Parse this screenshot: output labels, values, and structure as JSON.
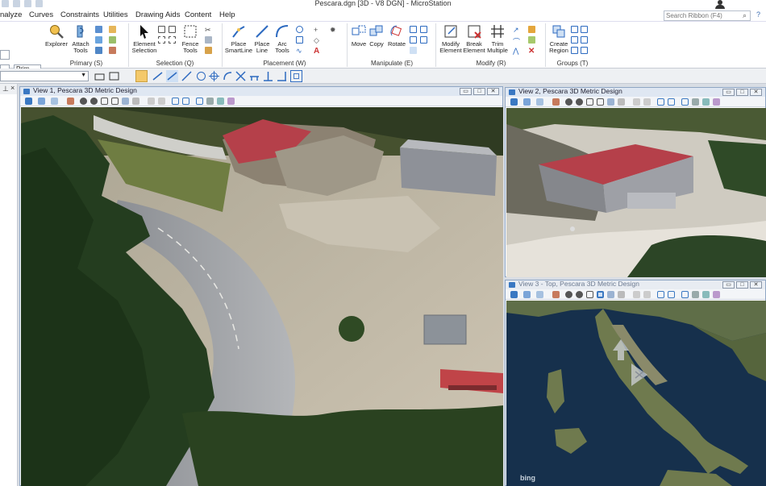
{
  "app": {
    "window_title": "Pescara.dgn [3D - V8 DGN] - MicroStation"
  },
  "menu": {
    "tabs": [
      "nalyze",
      "Curves",
      "Constraints",
      "Utilities",
      "Drawing Aids",
      "Content",
      "Help"
    ]
  },
  "search": {
    "placeholder": "Search Ribbon (F4)"
  },
  "ribbon": {
    "primary": {
      "label": "Primary (S)",
      "prim_value": "Prim",
      "explorer": "Explorer",
      "attach_tools": "Attach Tools"
    },
    "selection": {
      "label": "Selection (Q)",
      "element_selection": "Element Selection",
      "fence_tools": "Fence Tools"
    },
    "placement": {
      "label": "Placement (W)",
      "place_smartline": "Place SmartLine",
      "place_line": "Place Line",
      "arc_tools": "Arc Tools"
    },
    "manipulate": {
      "label": "Manipulate (E)",
      "move": "Move",
      "copy": "Copy",
      "rotate": "Rotate"
    },
    "modify": {
      "label": "Modify (R)",
      "modify_element": "Modify Element",
      "break_element": "Break Element",
      "trim_multiple": "Trim Multiple"
    },
    "groups": {
      "label": "Groups (T)",
      "create_region": "Create Region"
    }
  },
  "views": {
    "view1": {
      "title": "View 1, Pescara 3D Metric Design"
    },
    "view2": {
      "title": "View 2, Pescara 3D Metric Design"
    },
    "view3": {
      "title": "View 3 - Top, Pescara 3D Metric Design",
      "watermark": "bing"
    }
  },
  "colors": {
    "accent": "#3a78c2",
    "active_tool": "#f4c96a",
    "roof_red": "#b5404a"
  }
}
